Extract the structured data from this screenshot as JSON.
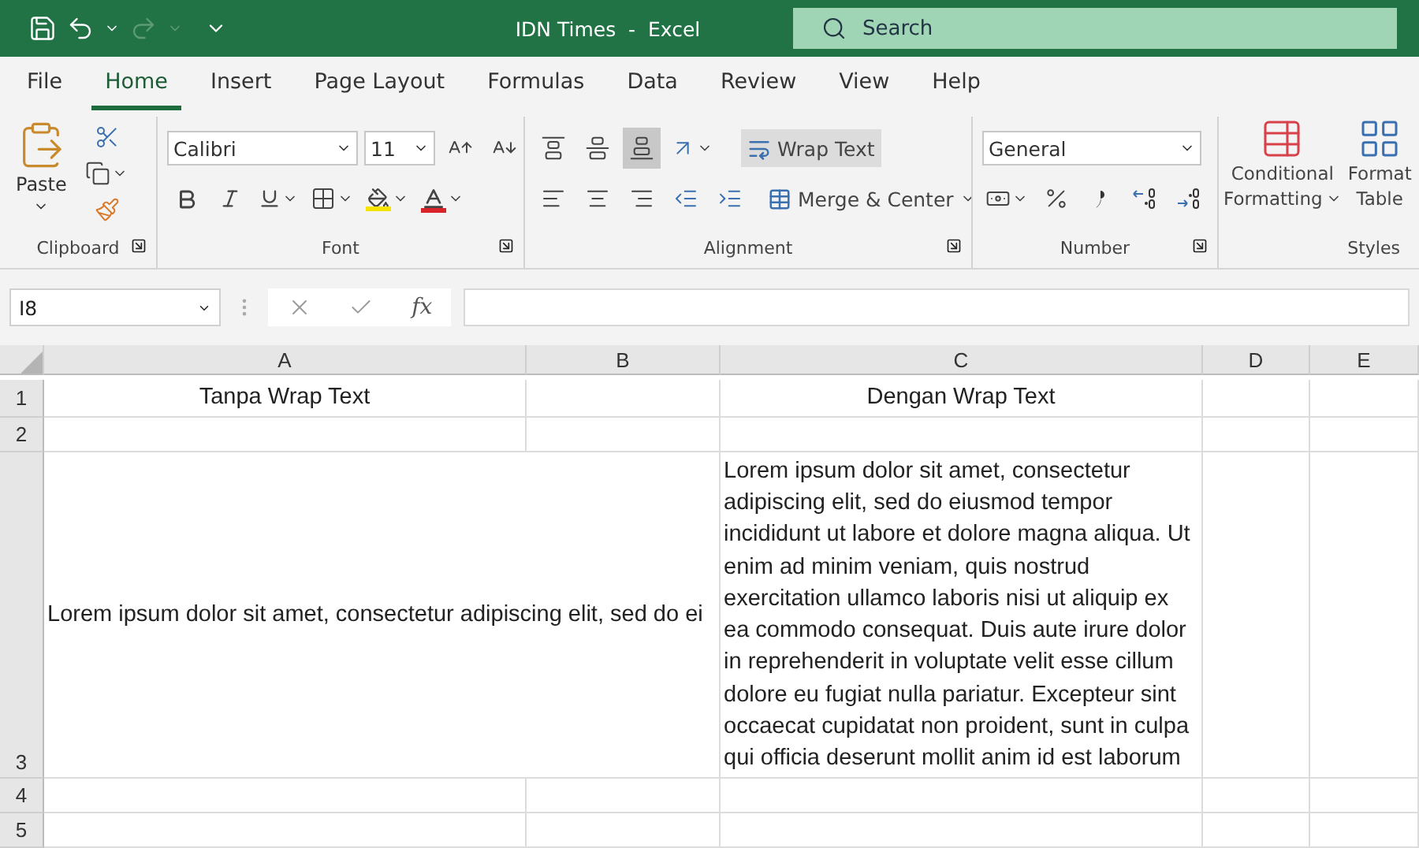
{
  "title_bar": {
    "title": "IDN Times  -  Excel",
    "search_placeholder": "Search"
  },
  "menu_tabs": [
    {
      "label": "File",
      "selected": false
    },
    {
      "label": "Home",
      "selected": true
    },
    {
      "label": "Insert",
      "selected": false
    },
    {
      "label": "Page Layout",
      "selected": false
    },
    {
      "label": "Formulas",
      "selected": false
    },
    {
      "label": "Data",
      "selected": false
    },
    {
      "label": "Review",
      "selected": false
    },
    {
      "label": "View",
      "selected": false
    },
    {
      "label": "Help",
      "selected": false
    }
  ],
  "ribbon": {
    "clipboard": {
      "paste_label": "Paste",
      "group_label": "Clipboard"
    },
    "font": {
      "font_name": "Calibri",
      "font_size": "11",
      "group_label": "Font"
    },
    "alignment": {
      "vertical_align": [
        {
          "kind": "top",
          "selected": false
        },
        {
          "kind": "middle",
          "selected": false
        },
        {
          "kind": "bottom",
          "selected": true
        }
      ],
      "wrap_text": {
        "label": "Wrap Text",
        "selected": true
      },
      "merge_label": "Merge & Center",
      "group_label": "Alignment"
    },
    "number": {
      "format": "General",
      "group_label": "Number"
    },
    "styles": {
      "conditional_formatting": [
        "Conditional",
        "Formatting"
      ],
      "format_as_table": [
        "Format",
        "Table"
      ],
      "group_label": "Styles"
    }
  },
  "formula_bar": {
    "name_box": "I8",
    "function_label": "fx"
  },
  "sheet": {
    "columns": [
      "A",
      "B",
      "C",
      "D",
      "E"
    ],
    "rows": [
      {
        "header": "1",
        "cells": [
          {
            "text": "Tanpa Wrap Text",
            "wrapped": false
          },
          {},
          {
            "text": "Dengan Wrap Text",
            "wrapped": false
          },
          {},
          {}
        ]
      },
      {
        "header": "2",
        "cells": [
          {},
          {},
          {},
          {},
          {}
        ]
      },
      {
        "header": "3",
        "cells": [
          {
            "text": "Lorem ipsum dolor sit amet, consectetur adipiscing elit, sed do ei",
            "wrapped": false
          },
          {},
          {
            "text": "Lorem ipsum dolor sit amet, consectetur adipiscing elit, sed do eiusmod tempor incididunt ut labore et dolore magna aliqua. Ut enim ad minim veniam, quis nostrud exercitation ullamco laboris nisi ut aliquip ex ea commodo consequat. Duis aute irure dolor in reprehenderit in voluptate velit esse cillum dolore eu fugiat nulla pariatur. Excepteur sint occaecat cupidatat non proident, sunt in culpa qui officia deserunt mollit anim id est laborum",
            "wrapped": true
          },
          {},
          {}
        ]
      },
      {
        "header": "4",
        "cells": [
          {},
          {},
          {},
          {},
          {}
        ]
      },
      {
        "header": "5",
        "cells": [
          {},
          {},
          {},
          {},
          {}
        ]
      }
    ]
  }
}
